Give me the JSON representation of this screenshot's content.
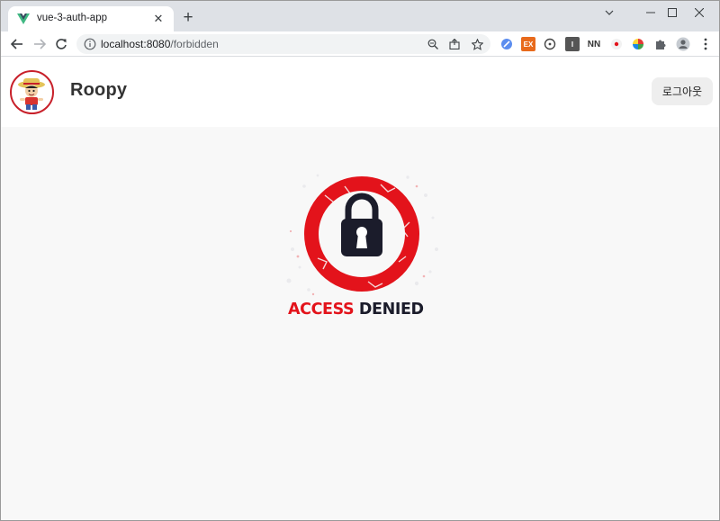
{
  "browser": {
    "tab": {
      "title": "vue-3-auth-app",
      "favicon": "vue-logo-icon",
      "close": "✕"
    },
    "new_tab": "+",
    "url_host": "localhost:8080",
    "url_path": "/forbidden",
    "extensions": [
      {
        "icon": "devtools-extension-icon",
        "color": "#5b8def"
      },
      {
        "icon": "extension-ex-icon",
        "label": "EX",
        "color": "#e86a1c"
      },
      {
        "icon": "extension-circle-icon"
      },
      {
        "icon": "extension-square-icon",
        "label": "I",
        "color": "#555555"
      },
      {
        "icon": "extension-nn-icon",
        "label": "NN"
      },
      {
        "icon": "extension-red-dot-icon",
        "color": "#e3131b"
      },
      {
        "icon": "extension-color-wheel-icon"
      },
      {
        "icon": "puzzle-icon"
      },
      {
        "icon": "profile-icon"
      },
      {
        "icon": "kebab-menu-icon"
      }
    ]
  },
  "app": {
    "brand": "Roopy",
    "avatar": "luffy-avatar",
    "logout_label": "로그아웃"
  },
  "content": {
    "image": "access-denied-lock-icon",
    "word1": "ACCESS",
    "word2": "DENIED",
    "accent": "#e3131b",
    "dark": "#1b1c2b"
  }
}
